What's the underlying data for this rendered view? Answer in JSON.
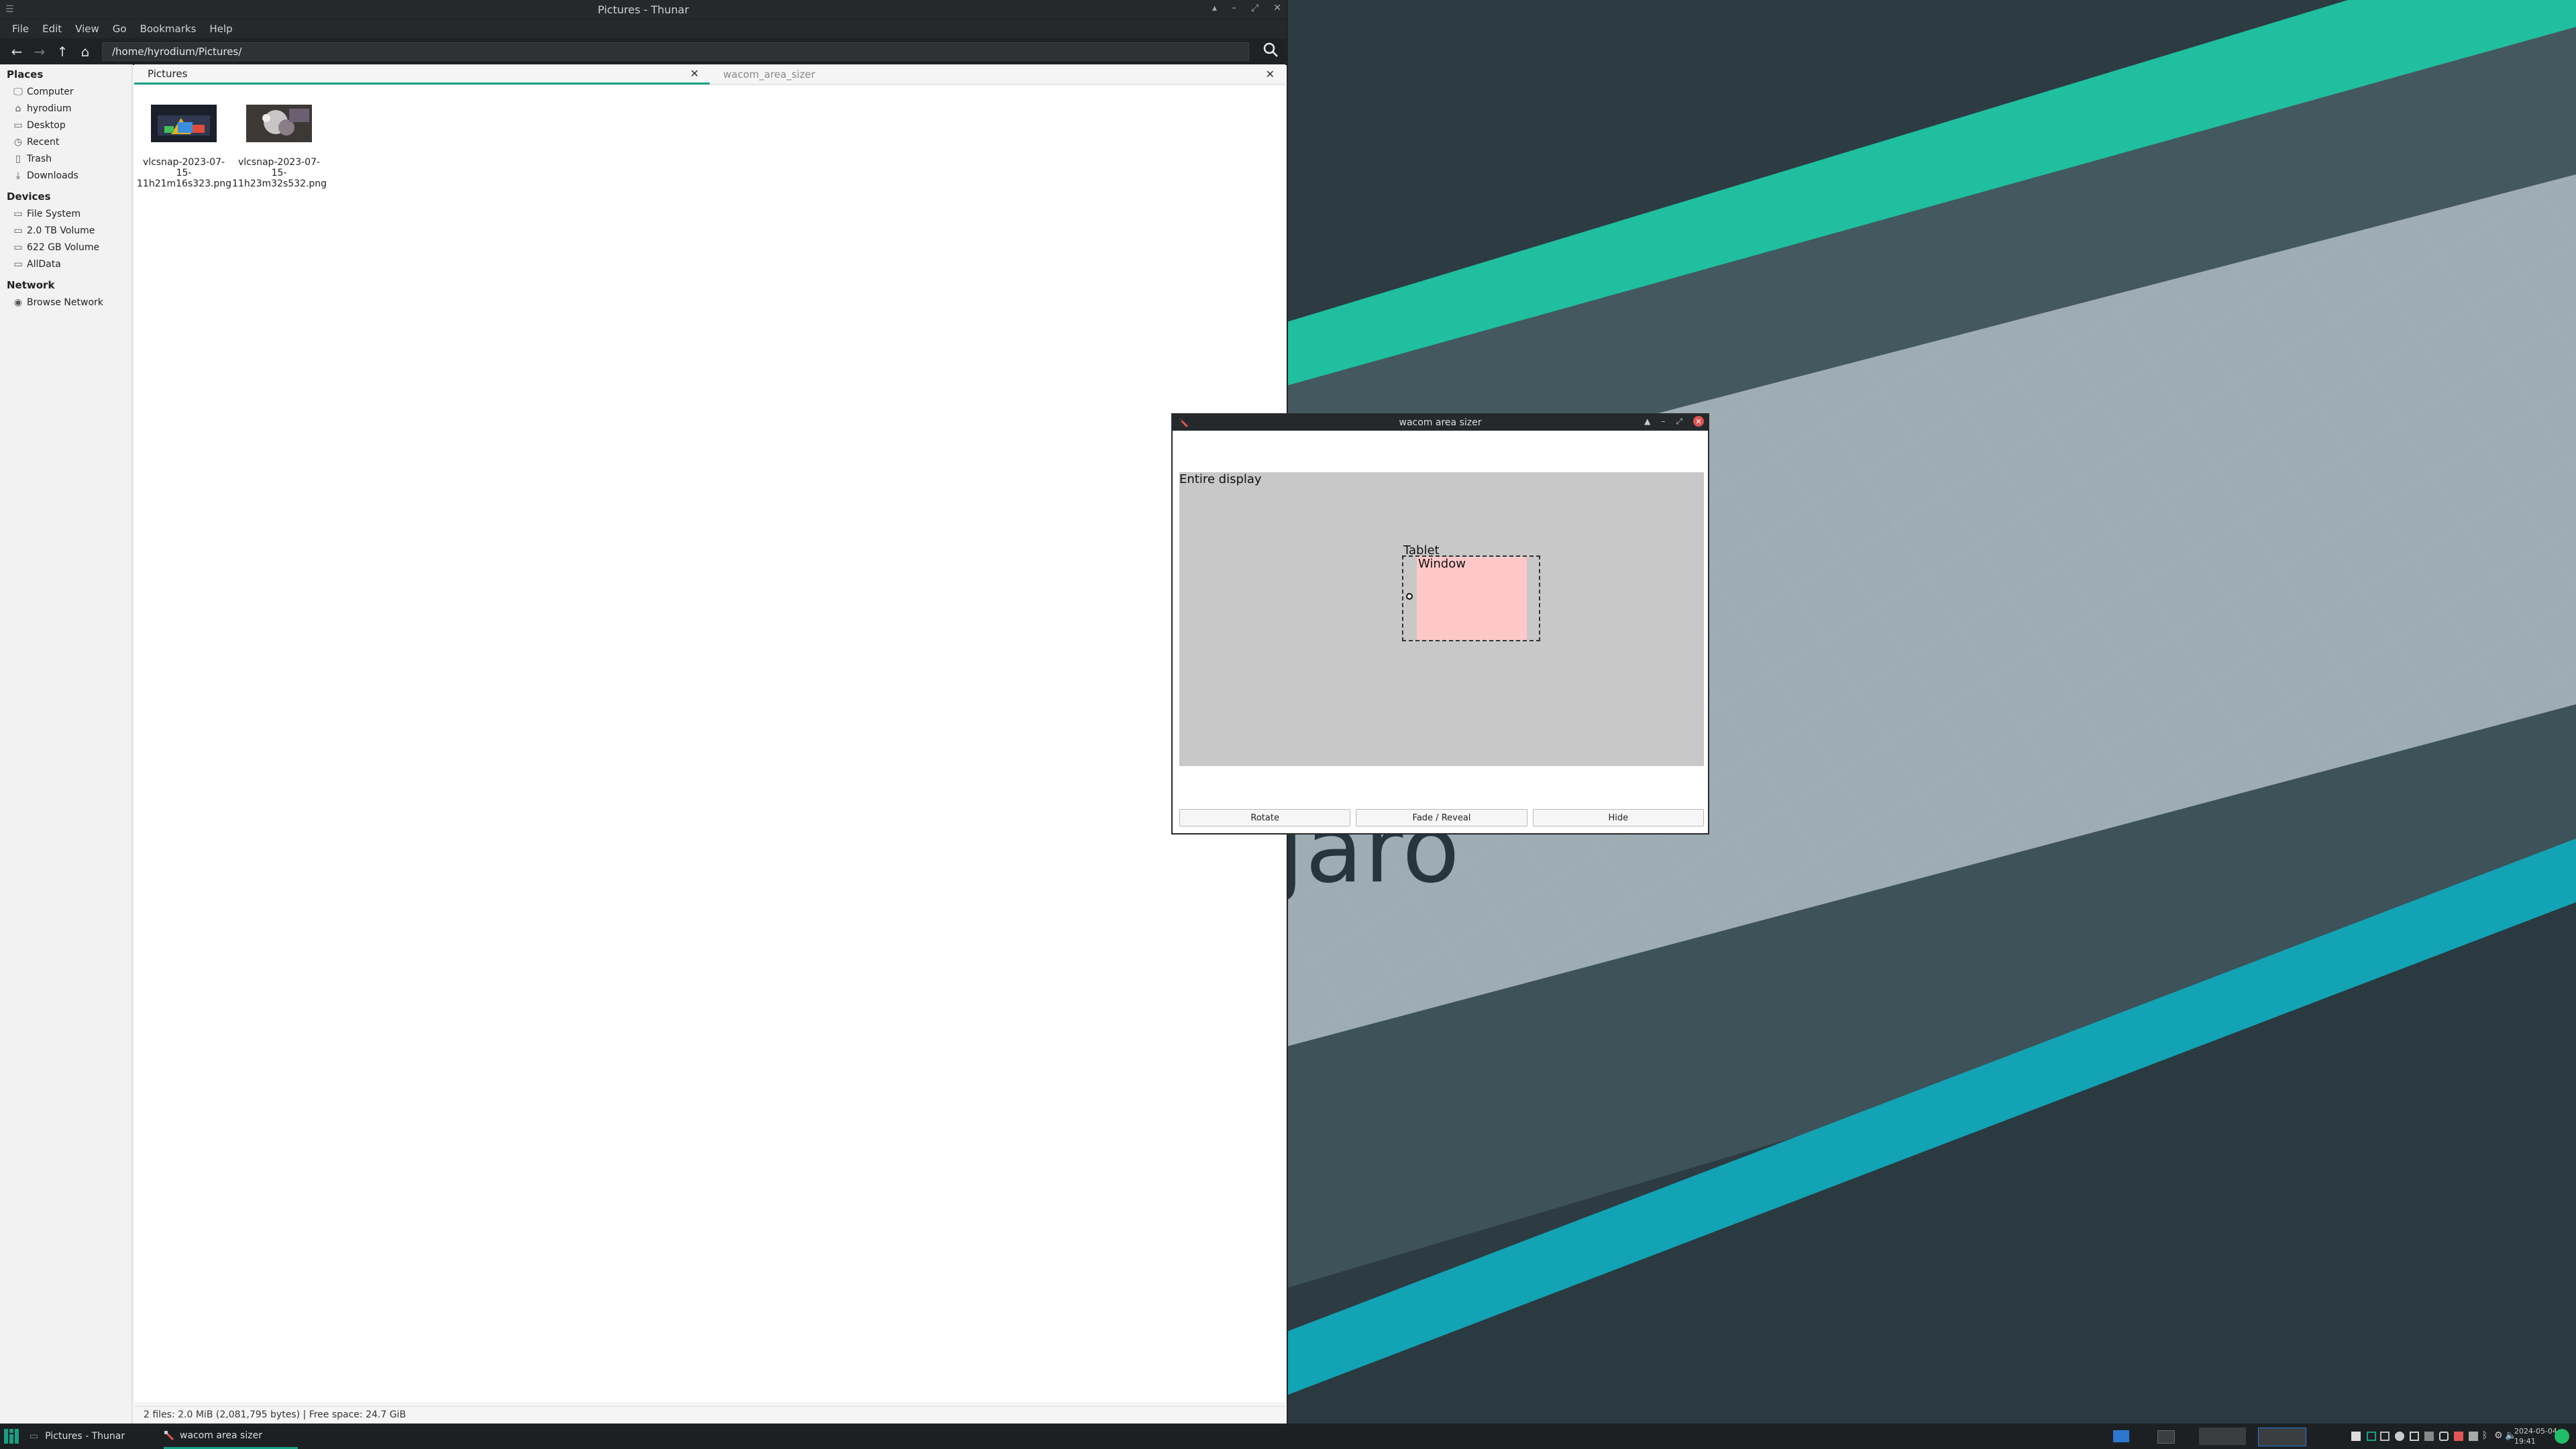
{
  "thunar": {
    "title": "Pictures - Thunar",
    "menu": [
      "File",
      "Edit",
      "View",
      "Go",
      "Bookmarks",
      "Help"
    ],
    "path": "/home/hyrodium/Pictures/",
    "sidebar": {
      "places_title": "Places",
      "places": [
        {
          "label": "Computer",
          "icon": "computer-icon"
        },
        {
          "label": "hyrodium",
          "icon": "home-icon"
        },
        {
          "label": "Desktop",
          "icon": "desktop-icon"
        },
        {
          "label": "Recent",
          "icon": "clock-icon"
        },
        {
          "label": "Trash",
          "icon": "trash-icon"
        },
        {
          "label": "Downloads",
          "icon": "download-icon"
        }
      ],
      "devices_title": "Devices",
      "devices": [
        {
          "label": "File System",
          "icon": "drive-icon"
        },
        {
          "label": "2.0 TB Volume",
          "icon": "drive-icon"
        },
        {
          "label": "622 GB Volume",
          "icon": "drive-icon"
        },
        {
          "label": "AllData",
          "icon": "drive-icon"
        }
      ],
      "network_title": "Network",
      "network": [
        {
          "label": "Browse Network",
          "icon": "network-icon"
        }
      ]
    },
    "tabs": [
      {
        "label": "Pictures",
        "active": true
      },
      {
        "label": "wacom_area_sizer",
        "active": false
      }
    ],
    "files": [
      {
        "name_line1": "vlcsnap-2023-07-15-",
        "name_line2": "11h21m16s323.png"
      },
      {
        "name_line1": "vlcsnap-2023-07-15-",
        "name_line2": "11h23m32s532.png"
      }
    ],
    "status": "2 files: 2.0 MiB (2,081,795 bytes)  |  Free space: 24.7 GiB"
  },
  "wacom": {
    "title": "wacom area sizer",
    "display_label": "Entire display",
    "tablet_label": "Tablet",
    "window_label": "Window",
    "buttons": [
      "Rotate",
      "Fade / Reveal",
      "Hide"
    ]
  },
  "wallpaper": {
    "watermark": "jaro"
  },
  "taskbar": {
    "tasks": [
      {
        "label": "Pictures - Thunar"
      },
      {
        "label": "wacom area sizer"
      }
    ],
    "clock_date": "2024-05-04",
    "clock_time": "19:41"
  },
  "colors": {
    "accent": "#16a085",
    "window_area": "#ffc8c8",
    "display_area": "#c8c8c8",
    "stripe_green": "#1fbfa0",
    "stripe_cyan": "#12a3b4"
  }
}
